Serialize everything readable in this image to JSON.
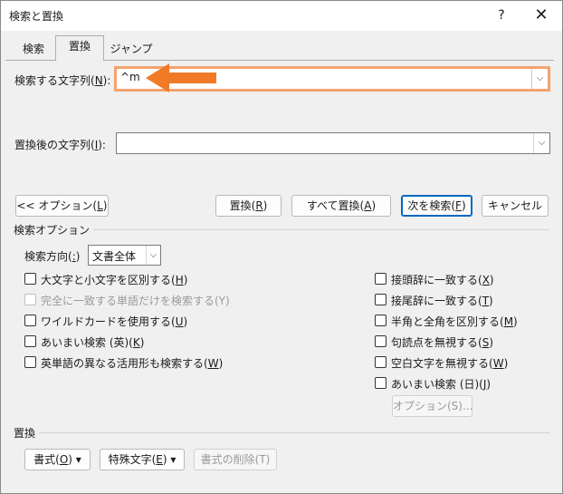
{
  "window": {
    "title": "検索と置換",
    "help_label": "?",
    "close_label": "✕"
  },
  "tabs": [
    {
      "label": "検索",
      "active": false
    },
    {
      "label": "置換",
      "active": true
    },
    {
      "label": "ジャンプ",
      "active": false
    }
  ],
  "find": {
    "label_prefix": "検索する文字列(",
    "label_key": "N",
    "label_suffix": "):",
    "value": "^m"
  },
  "replace": {
    "label_prefix": "置換後の文字列(",
    "label_key": "I",
    "label_suffix": "):",
    "value": ""
  },
  "buttons": {
    "options_prefix": "<< オプション(",
    "options_key": "L",
    "options_suffix": ")",
    "replace_prefix": "置換(",
    "replace_key": "R",
    "replace_suffix": ")",
    "replace_all_prefix": "すべて置換(",
    "replace_all_key": "A",
    "replace_all_suffix": ")",
    "find_next_prefix": "次を検索(",
    "find_next_key": "F",
    "find_next_suffix": ")",
    "cancel": "キャンセル"
  },
  "search_options": {
    "title": "検索オプション",
    "direction_prefix": "検索方向(",
    "direction_key": ":",
    "direction_suffix": ")",
    "direction_value": "文書全体",
    "left": [
      {
        "prefix": "大文字と小文字を区別する(",
        "key": "H",
        "suffix": ")",
        "disabled": false
      },
      {
        "prefix": "完全に一致する単語だけを検索する(Y)",
        "key": "",
        "suffix": "",
        "disabled": true
      },
      {
        "prefix": "ワイルドカードを使用する(",
        "key": "U",
        "suffix": ")",
        "disabled": false
      },
      {
        "prefix": "あいまい検索 (英)(",
        "key": "K",
        "suffix": ")",
        "disabled": false
      },
      {
        "prefix": "英単語の異なる活用形も検索する(",
        "key": "W",
        "suffix": ")",
        "disabled": false
      }
    ],
    "right": [
      {
        "prefix": "接頭辞に一致する(",
        "key": "X",
        "suffix": ")"
      },
      {
        "prefix": "接尾辞に一致する(",
        "key": "T",
        "suffix": ")"
      },
      {
        "prefix": "半角と全角を区別する(",
        "key": "M",
        "suffix": ")"
      },
      {
        "prefix": "句読点を無視する(",
        "key": "S",
        "suffix": ")"
      },
      {
        "prefix": "空白文字を無視する(",
        "key": "W",
        "suffix": ")"
      },
      {
        "prefix": "あいまい検索 (日)(",
        "key": "J",
        "suffix": ")"
      }
    ],
    "fuzzy_options_button": "オプション(S)..."
  },
  "replace_group": {
    "title": "置換",
    "format_prefix": "書式(",
    "format_key": "O",
    "format_suffix": ") ▾",
    "special_prefix": "特殊文字(",
    "special_key": "E",
    "special_suffix": ") ▾",
    "remove_format": "書式の削除(T)"
  },
  "colors": {
    "annotation_arrow": "#f07a26",
    "default_button_border": "#0067c0"
  }
}
